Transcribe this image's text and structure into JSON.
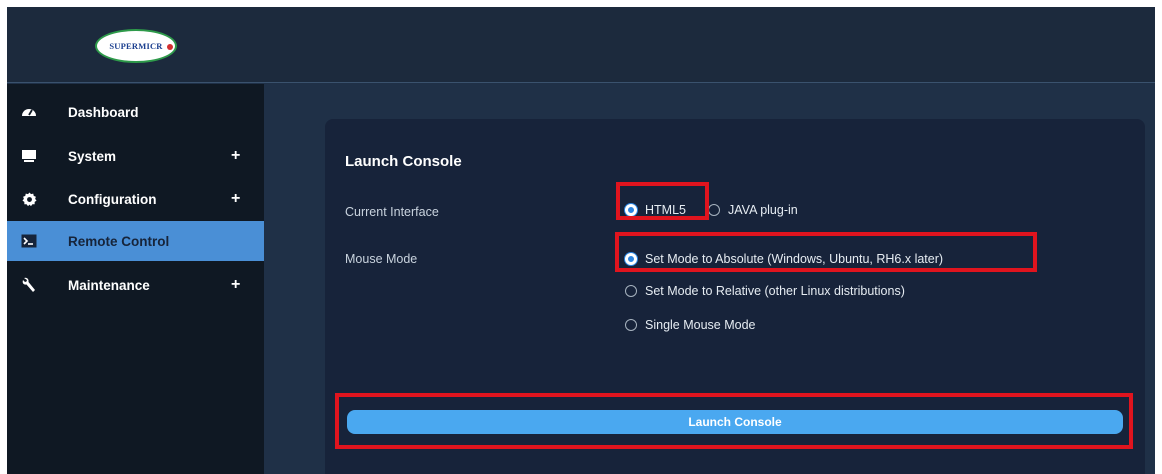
{
  "brand": {
    "logo_text": "SUPERMICR"
  },
  "sidebar": {
    "items": [
      {
        "label": "Dashboard",
        "icon": "speedometer-icon",
        "expandable": false,
        "active": false
      },
      {
        "label": "System",
        "icon": "monitor-icon",
        "expandable": true,
        "active": false
      },
      {
        "label": "Configuration",
        "icon": "gear-icon",
        "expandable": true,
        "active": false
      },
      {
        "label": "Remote Control",
        "icon": "terminal-icon",
        "expandable": false,
        "active": true
      },
      {
        "label": "Maintenance",
        "icon": "wrench-icon",
        "expandable": true,
        "active": false
      }
    ],
    "expand_glyph": "+"
  },
  "panel": {
    "title": "Launch Console",
    "current_interface": {
      "label": "Current Interface",
      "options": [
        "HTML5",
        "JAVA plug-in"
      ],
      "selected": "HTML5"
    },
    "mouse_mode": {
      "label": "Mouse Mode",
      "options": [
        "Set Mode to Absolute (Windows, Ubuntu, RH6.x later)",
        "Set Mode to Relative (other Linux distributions)",
        "Single Mouse Mode"
      ],
      "selected": "Set Mode to Absolute (Windows, Ubuntu, RH6.x later)"
    },
    "launch_button_label": "Launch Console"
  },
  "colors": {
    "highlight": "#e0141e",
    "active_nav": "#4a8fd6",
    "button": "#4aa8f0",
    "panel": "#17233a",
    "sidebar": "#0f1823"
  }
}
